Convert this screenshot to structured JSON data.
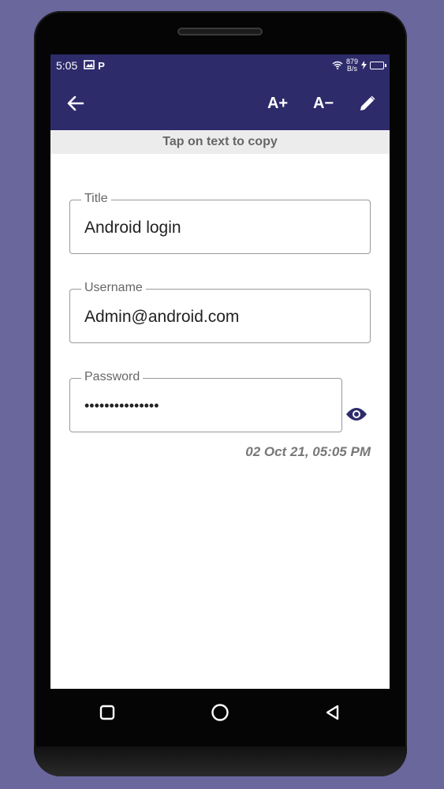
{
  "status_bar": {
    "time": "5:05",
    "net_speed_value": "879",
    "net_speed_unit": "B/s",
    "icons": [
      "gallery-icon",
      "p-icon",
      "wifi-icon",
      "charging-icon",
      "battery-icon"
    ]
  },
  "toolbar": {
    "back_icon": "arrow-left-icon",
    "increase_font_label": "A+",
    "decrease_font_label": "A−",
    "edit_icon": "pencil-icon"
  },
  "copy_hint": "Tap on text to copy",
  "fields": {
    "title": {
      "label": "Title",
      "value": "Android login"
    },
    "username": {
      "label": "Username",
      "value": "Admin@android.com"
    },
    "password": {
      "label": "Password",
      "value": "•••••••••••••••"
    }
  },
  "visibility_icon": "eye-icon",
  "timestamp": "02 Oct 21, 05:05 PM",
  "nav_bar": [
    "recents-square-icon",
    "home-circle-icon",
    "back-triangle-icon"
  ],
  "colors": {
    "app_bar": "#2e2b6b",
    "background": "#6a679c",
    "eye_icon": "#2e2b6b"
  }
}
